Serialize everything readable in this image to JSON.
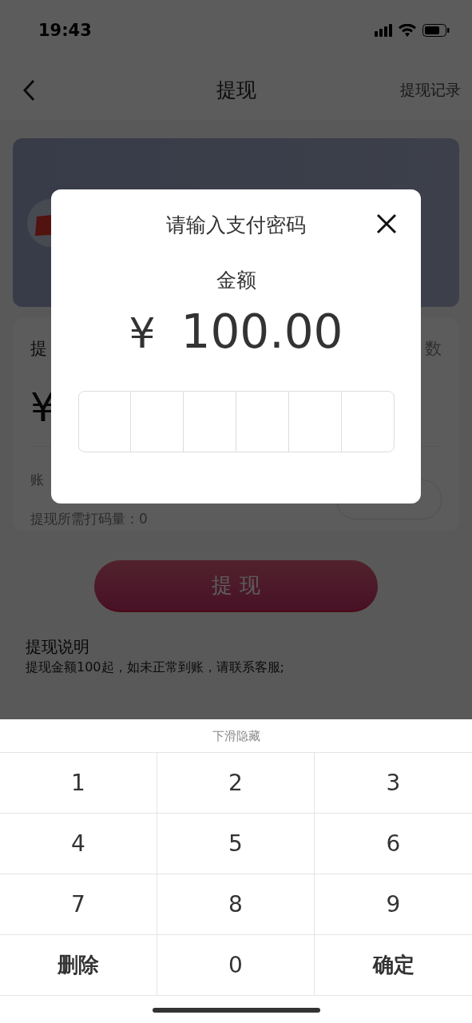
{
  "status_bar": {
    "time": "19:43"
  },
  "nav": {
    "title": "提现",
    "action": "提现记录"
  },
  "form": {
    "label": "提",
    "right_text": "数",
    "currency": "¥",
    "account_label": "账",
    "requirement": "提现所需打码量：0"
  },
  "withdraw_button": "提 现",
  "notes": {
    "title": "提现说明",
    "text": "提现金额100起，如未正常到账，请联系客服;"
  },
  "dialog": {
    "title": "请输入支付密码",
    "amount_label": "金额",
    "currency": "¥",
    "amount": "100.00",
    "pin_cells": [
      {
        "filled": false
      },
      {
        "filled": false
      },
      {
        "filled": false
      },
      {
        "filled": false
      },
      {
        "filled": false
      },
      {
        "filled": false
      }
    ]
  },
  "keyboard": {
    "hint": "下滑隐藏",
    "keys": [
      {
        "label": "1",
        "kind": "digit"
      },
      {
        "label": "2",
        "kind": "digit"
      },
      {
        "label": "3",
        "kind": "digit"
      },
      {
        "label": "4",
        "kind": "digit"
      },
      {
        "label": "5",
        "kind": "digit"
      },
      {
        "label": "6",
        "kind": "digit"
      },
      {
        "label": "7",
        "kind": "digit"
      },
      {
        "label": "8",
        "kind": "digit"
      },
      {
        "label": "9",
        "kind": "digit"
      },
      {
        "label": "删除",
        "kind": "action"
      },
      {
        "label": "0",
        "kind": "digit"
      },
      {
        "label": "确定",
        "kind": "action"
      }
    ]
  }
}
